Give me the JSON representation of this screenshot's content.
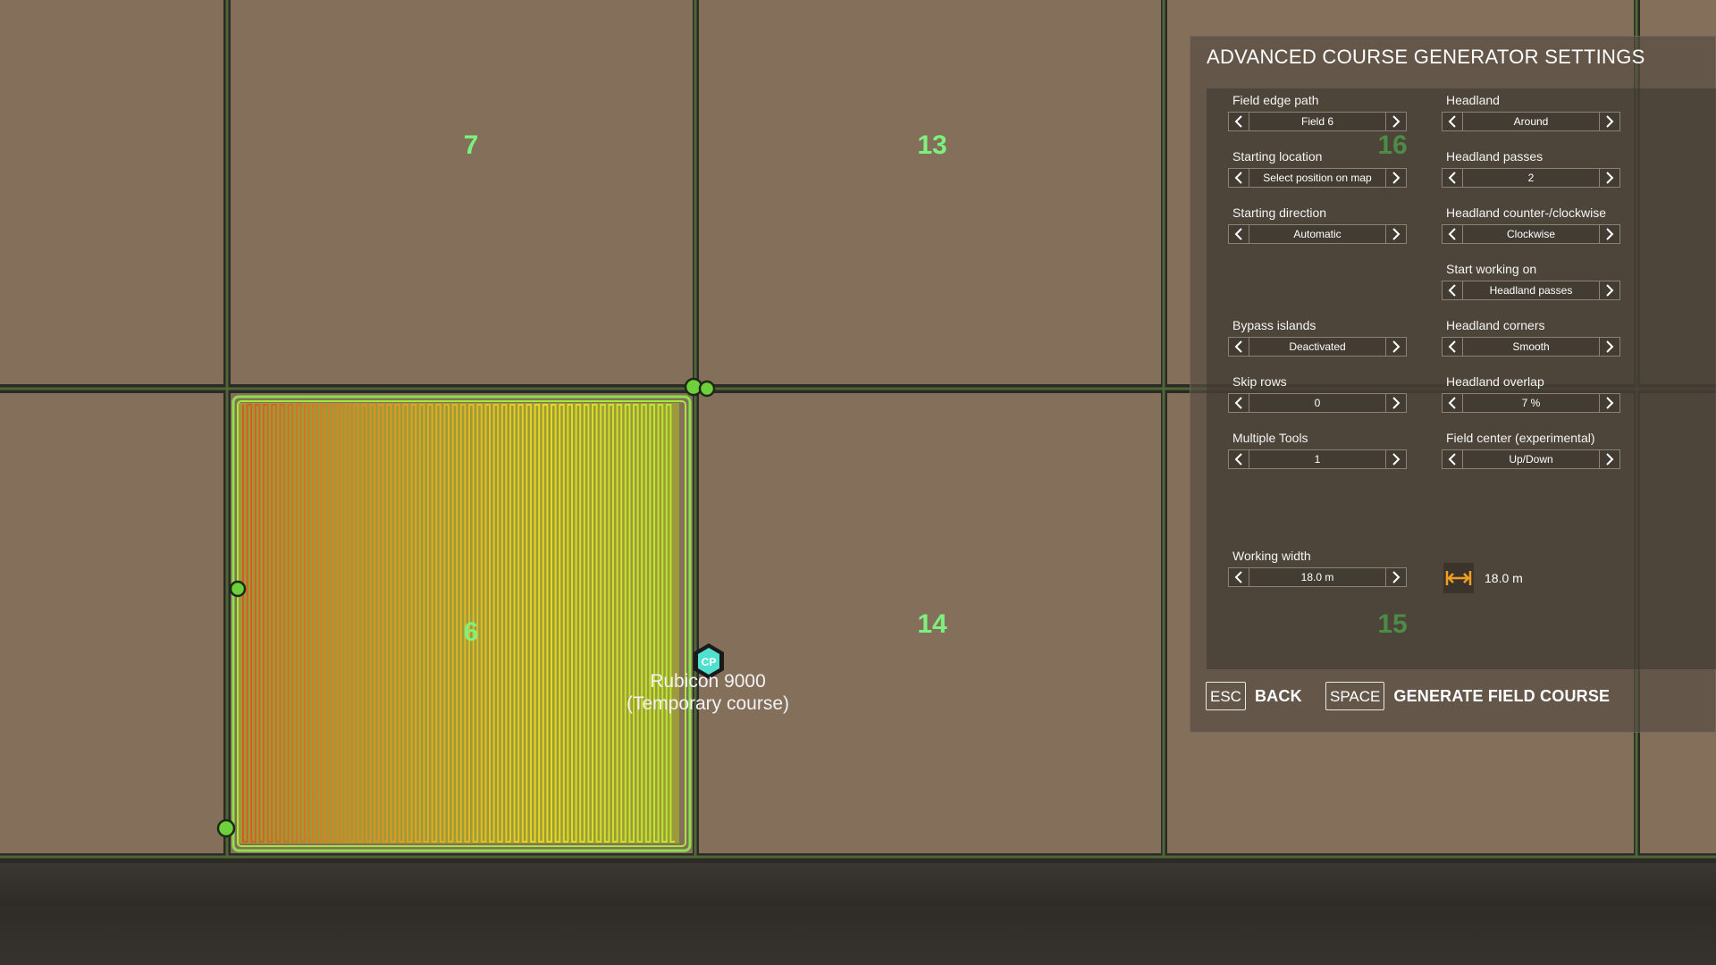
{
  "map": {
    "field_numbers": [
      "7",
      "13",
      "6",
      "14",
      "16",
      "15"
    ],
    "vehicle": {
      "name": "Rubicon 9000",
      "course": "(Temporary course)",
      "marker_text": "CP"
    },
    "colors": {
      "soil": "#846f5b",
      "field_number": "#7ef07e",
      "course_outline": "#8ee04a"
    }
  },
  "panel": {
    "title": "ADVANCED COURSE GENERATOR SETTINGS",
    "settings": {
      "field_edge_path": {
        "label": "Field edge path",
        "value": "Field 6"
      },
      "headland": {
        "label": "Headland",
        "value": "Around"
      },
      "starting_location": {
        "label": "Starting location",
        "value": "Select position on map"
      },
      "headland_passes": {
        "label": "Headland passes",
        "value": "2"
      },
      "starting_direction": {
        "label": "Starting direction",
        "value": "Automatic"
      },
      "headland_direction": {
        "label": "Headland counter-/clockwise",
        "value": "Clockwise"
      },
      "start_working_on": {
        "label": "Start working on",
        "value": "Headland passes"
      },
      "bypass_islands": {
        "label": "Bypass islands",
        "value": "Deactivated"
      },
      "headland_corners": {
        "label": "Headland corners",
        "value": "Smooth"
      },
      "skip_rows": {
        "label": "Skip rows",
        "value": "0"
      },
      "headland_overlap": {
        "label": "Headland overlap",
        "value": "7 %"
      },
      "multiple_tools": {
        "label": "Multiple Tools",
        "value": "1"
      },
      "field_center": {
        "label": "Field center (experimental)",
        "value": "Up/Down"
      },
      "working_width": {
        "label": "Working width",
        "value": "18.0 m"
      }
    },
    "width_readout": {
      "icon": "width-arrows-icon",
      "value": "18.0 m",
      "icon_color": "#f0a020"
    },
    "footer": {
      "back": {
        "key": "ESC",
        "label": "BACK"
      },
      "generate": {
        "key": "SPACE",
        "label": "GENERATE FIELD COURSE"
      }
    }
  }
}
